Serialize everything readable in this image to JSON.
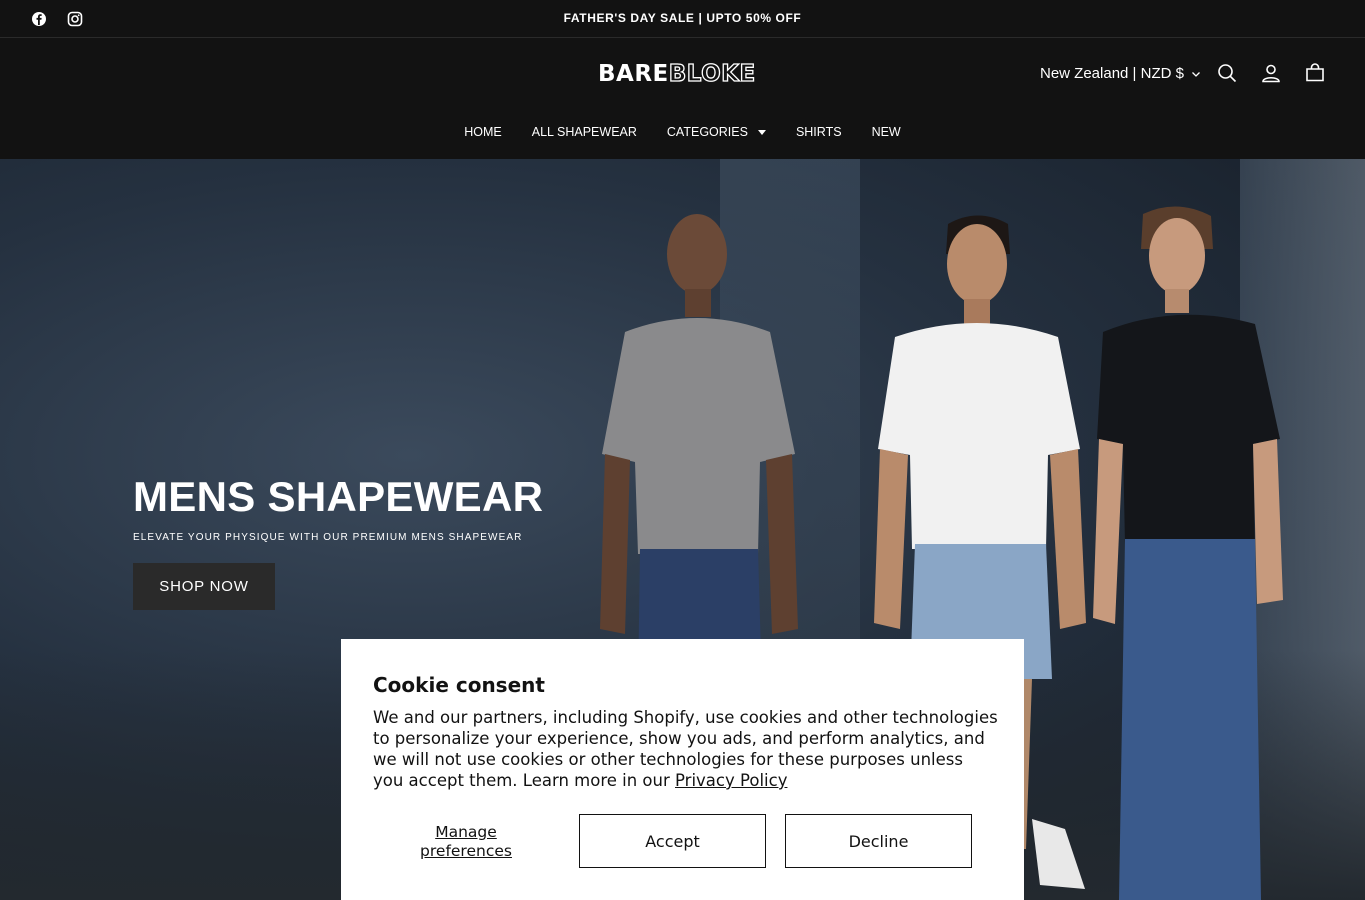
{
  "announcement": {
    "text": "FATHER'S DAY SALE | UPTO 50% OFF",
    "social": [
      "facebook-icon",
      "instagram-icon"
    ]
  },
  "header": {
    "logo_part1": "BARE",
    "logo_part2": "BLOKE",
    "locale": "New Zealand | NZD $",
    "icons": [
      "search-icon",
      "account-icon",
      "cart-icon"
    ]
  },
  "nav": {
    "items": [
      {
        "label": "HOME"
      },
      {
        "label": "ALL SHAPEWEAR"
      },
      {
        "label": "CATEGORIES"
      },
      {
        "label": "SHIRTS"
      },
      {
        "label": "NEW"
      }
    ]
  },
  "hero": {
    "title": "MENS SHAPEWEAR",
    "subtitle": "ELEVATE YOUR PHYSIQUE WITH OUR PREMIUM MENS SHAPEWEAR",
    "cta": "SHOP NOW"
  },
  "cookie": {
    "title": "Cookie consent",
    "body": "We and our partners, including Shopify, use cookies and other technologies to personalize your experience, show you ads, and perform analytics, and we will not use cookies or other technologies for these purposes unless you accept them. Learn more in our ",
    "link": "Privacy Policy",
    "manage": "Manage preferences",
    "accept": "Accept",
    "decline": "Decline"
  },
  "colors": {
    "header_bg": "#121212",
    "text": "#ffffff",
    "button_dark": "#2a2a2a"
  }
}
